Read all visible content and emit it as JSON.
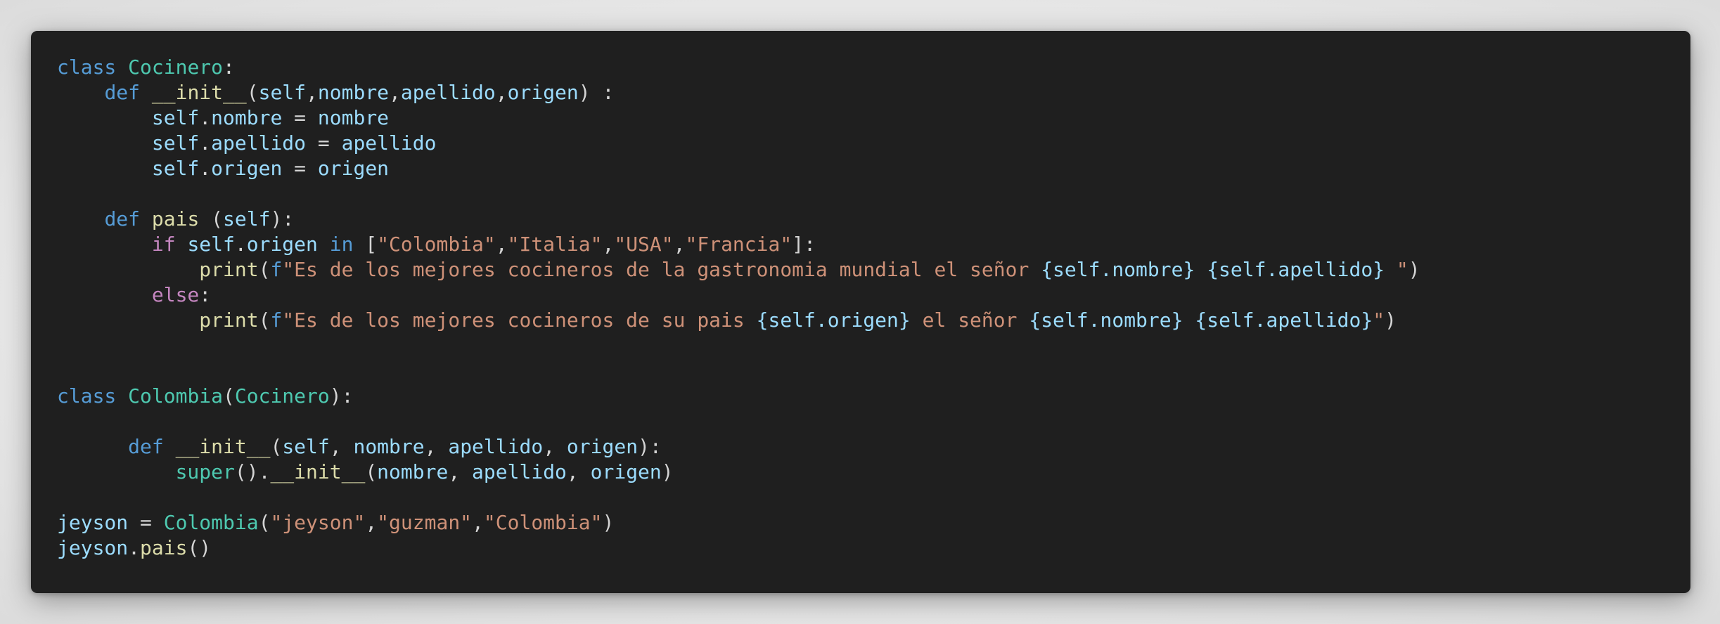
{
  "editor": {
    "language": "python",
    "lines": [
      [
        [
          "kw",
          "class"
        ],
        [
          "pl",
          " "
        ],
        [
          "cls",
          "Cocinero"
        ],
        [
          "pl",
          ":"
        ]
      ],
      [
        [
          "pl",
          "    "
        ],
        [
          "kw",
          "def"
        ],
        [
          "pl",
          " "
        ],
        [
          "fn",
          "__init__"
        ],
        [
          "pl",
          "("
        ],
        [
          "var",
          "self"
        ],
        [
          "pl",
          ","
        ],
        [
          "var",
          "nombre"
        ],
        [
          "pl",
          ","
        ],
        [
          "var",
          "apellido"
        ],
        [
          "pl",
          ","
        ],
        [
          "var",
          "origen"
        ],
        [
          "pl",
          ") :"
        ]
      ],
      [
        [
          "pl",
          "        "
        ],
        [
          "var",
          "self"
        ],
        [
          "pl",
          "."
        ],
        [
          "var",
          "nombre"
        ],
        [
          "pl",
          " = "
        ],
        [
          "var",
          "nombre"
        ]
      ],
      [
        [
          "pl",
          "        "
        ],
        [
          "var",
          "self"
        ],
        [
          "pl",
          "."
        ],
        [
          "var",
          "apellido"
        ],
        [
          "pl",
          " = "
        ],
        [
          "var",
          "apellido"
        ]
      ],
      [
        [
          "pl",
          "        "
        ],
        [
          "var",
          "self"
        ],
        [
          "pl",
          "."
        ],
        [
          "var",
          "origen"
        ],
        [
          "pl",
          " = "
        ],
        [
          "var",
          "origen"
        ]
      ],
      [],
      [
        [
          "pl",
          "    "
        ],
        [
          "kw",
          "def"
        ],
        [
          "pl",
          " "
        ],
        [
          "fn",
          "pais"
        ],
        [
          "pl",
          " ("
        ],
        [
          "var",
          "self"
        ],
        [
          "pl",
          "):"
        ]
      ],
      [
        [
          "pl",
          "        "
        ],
        [
          "ctrl",
          "if"
        ],
        [
          "pl",
          " "
        ],
        [
          "var",
          "self"
        ],
        [
          "pl",
          "."
        ],
        [
          "var",
          "origen"
        ],
        [
          "pl",
          " "
        ],
        [
          "kw",
          "in"
        ],
        [
          "pl",
          " ["
        ],
        [
          "str",
          "\"Colombia\""
        ],
        [
          "pl",
          ","
        ],
        [
          "str",
          "\"Italia\""
        ],
        [
          "pl",
          ","
        ],
        [
          "str",
          "\"USA\""
        ],
        [
          "pl",
          ","
        ],
        [
          "str",
          "\"Francia\""
        ],
        [
          "pl",
          "]:"
        ]
      ],
      [
        [
          "pl",
          "            "
        ],
        [
          "fn",
          "print"
        ],
        [
          "pl",
          "("
        ],
        [
          "kw",
          "f"
        ],
        [
          "str",
          "\"Es de los mejores cocineros de la gastronomia mundial el señor "
        ],
        [
          "var",
          "{self.nombre}"
        ],
        [
          "str",
          " "
        ],
        [
          "var",
          "{self.apellido}"
        ],
        [
          "str",
          " \""
        ],
        [
          "pl",
          ")"
        ]
      ],
      [
        [
          "pl",
          "        "
        ],
        [
          "ctrl",
          "else"
        ],
        [
          "pl",
          ":"
        ]
      ],
      [
        [
          "pl",
          "            "
        ],
        [
          "fn",
          "print"
        ],
        [
          "pl",
          "("
        ],
        [
          "kw",
          "f"
        ],
        [
          "str",
          "\"Es de los mejores cocineros de su pais "
        ],
        [
          "var",
          "{self.origen}"
        ],
        [
          "str",
          " el señor "
        ],
        [
          "var",
          "{self.nombre}"
        ],
        [
          "str",
          " "
        ],
        [
          "var",
          "{self.apellido}"
        ],
        [
          "str",
          "\""
        ],
        [
          "pl",
          ")"
        ]
      ],
      [],
      [],
      [
        [
          "kw",
          "class"
        ],
        [
          "pl",
          " "
        ],
        [
          "cls",
          "Colombia"
        ],
        [
          "pl",
          "("
        ],
        [
          "cls",
          "Cocinero"
        ],
        [
          "pl",
          "):"
        ]
      ],
      [],
      [
        [
          "pl",
          "      "
        ],
        [
          "kw",
          "def"
        ],
        [
          "pl",
          " "
        ],
        [
          "fn",
          "__init__"
        ],
        [
          "pl",
          "("
        ],
        [
          "var",
          "self"
        ],
        [
          "pl",
          ", "
        ],
        [
          "var",
          "nombre"
        ],
        [
          "pl",
          ", "
        ],
        [
          "var",
          "apellido"
        ],
        [
          "pl",
          ", "
        ],
        [
          "var",
          "origen"
        ],
        [
          "pl",
          "):"
        ]
      ],
      [
        [
          "pl",
          "          "
        ],
        [
          "cls",
          "super"
        ],
        [
          "pl",
          "()."
        ],
        [
          "fn",
          "__init__"
        ],
        [
          "pl",
          "("
        ],
        [
          "var",
          "nombre"
        ],
        [
          "pl",
          ", "
        ],
        [
          "var",
          "apellido"
        ],
        [
          "pl",
          ", "
        ],
        [
          "var",
          "origen"
        ],
        [
          "pl",
          ")"
        ]
      ],
      [],
      [
        [
          "var",
          "jeyson"
        ],
        [
          "pl",
          " = "
        ],
        [
          "cls",
          "Colombia"
        ],
        [
          "pl",
          "("
        ],
        [
          "str",
          "\"jeyson\""
        ],
        [
          "pl",
          ","
        ],
        [
          "str",
          "\"guzman\""
        ],
        [
          "pl",
          ","
        ],
        [
          "str",
          "\"Colombia\""
        ],
        [
          "pl",
          ")"
        ]
      ],
      [
        [
          "var",
          "jeyson"
        ],
        [
          "pl",
          "."
        ],
        [
          "fn",
          "pais"
        ],
        [
          "pl",
          "()"
        ]
      ]
    ]
  }
}
